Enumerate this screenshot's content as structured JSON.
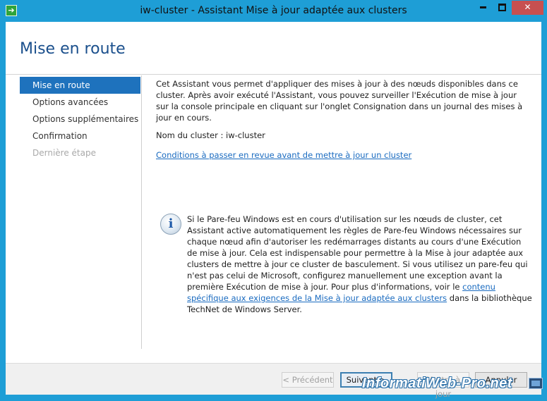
{
  "window": {
    "title": "iw-cluster - Assistant Mise à jour adaptée aux clusters",
    "controls": {
      "minimize": "minimize-icon",
      "maximize": "maximize-icon",
      "close": "✕"
    }
  },
  "header": {
    "title": "Mise en route"
  },
  "nav": {
    "items": [
      {
        "label": "Mise en route",
        "state": "active"
      },
      {
        "label": "Options avancées",
        "state": "normal"
      },
      {
        "label": "Options supplémentaires",
        "state": "normal"
      },
      {
        "label": "Confirmation",
        "state": "normal"
      },
      {
        "label": "Dernière étape",
        "state": "disabled"
      }
    ]
  },
  "content": {
    "intro": "Cet Assistant vous permet d'appliquer des mises à jour à des nœuds disponibles dans ce cluster. Après avoir exécuté l'Assistant, vous pouvez surveiller l'Exécution de mise à jour sur la console principale en cliquant sur l'onglet Consignation dans un journal des mises à jour en cours.",
    "cluster_name": "Nom du cluster : iw-cluster",
    "conditions_link": "Conditions à passer en revue avant de mettre à jour un cluster"
  },
  "info": {
    "icon": "info-icon",
    "text_before": "Si le Pare-feu Windows est en cours d'utilisation sur les nœuds de cluster, cet Assistant active automatiquement les règles de Pare-feu Windows nécessaires sur chaque nœud afin d'autoriser les redémarrages distants au cours d'une Exécution de mise à jour. Cela est indispensable pour permettre à la Mise à jour adaptée aux clusters de mettre à jour ce cluster de basculement. Si vous utilisez un pare-feu qui n'est pas celui de Microsoft, configurez manuellement une exception avant la première Exécution de mise à jour. Pour plus d'informations, voir le ",
    "link": "contenu spécifique aux exigences de la Mise à jour adaptée aux clusters",
    "text_after": " dans la bibliothèque TechNet de Windows Server."
  },
  "footer": {
    "prev": "< Précédent",
    "next": "Suivant >",
    "apply": "Mettre à jour",
    "cancel": "Annuler"
  },
  "watermark": "InformatiWeb-Pro.net",
  "colors": {
    "frame": "#1e9ed6",
    "nav_active": "#1e72bd",
    "title": "#1a4f8c",
    "link": "#1a6bc0",
    "close_button": "#c75050"
  }
}
